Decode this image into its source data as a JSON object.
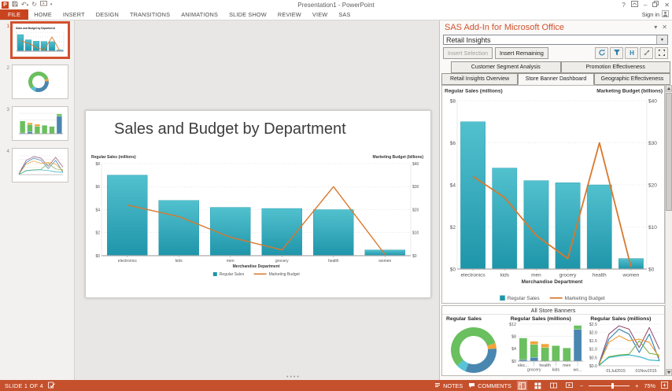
{
  "window": {
    "title": "Presentation1 - PowerPoint",
    "sign_in": "Sign in",
    "ribbon_tabs": [
      "FILE",
      "HOME",
      "INSERT",
      "DESIGN",
      "TRANSITIONS",
      "ANIMATIONS",
      "SLIDE SHOW",
      "REVIEW",
      "VIEW",
      "SAS"
    ]
  },
  "thumbnails": {
    "numbers": [
      "1",
      "2",
      "3",
      "4"
    ]
  },
  "slide": {
    "title": "Sales and Budget by Department"
  },
  "sas_panel": {
    "title": "SAS Add-In for Microsoft Office",
    "report_selector": "Retail Insights",
    "buttons": {
      "insert_selection": "Insert Selection",
      "insert_remaining": "Insert Remaining"
    },
    "tabs_row1": [
      "Customer Segment Analysis",
      "Promotion Effectiveness"
    ],
    "tabs_row2": [
      "Retail Insights Overview",
      "Store Banner Dashboard",
      "Geographic Effectiveness"
    ],
    "active_tab": "Store Banner Dashboard",
    "banners_title": "All Store Banners"
  },
  "status_bar": {
    "slide_indicator": "SLIDE 1 OF 4",
    "notes": "NOTES",
    "comments": "COMMENTS",
    "zoom": "75%"
  },
  "colors": {
    "accent_orange": "#c8441f",
    "status_bar": "#c5502c",
    "sas_header_text": "#d2512e",
    "bar_teal": "#1f95aa",
    "line_orange": "#d9782d"
  },
  "chart_data": [
    {
      "type": "bar+line",
      "categories": [
        "electronics",
        "kids",
        "men",
        "grocery",
        "health",
        "women"
      ],
      "xlabel": "Merchandise Department",
      "left_axis": {
        "label": "Regular Sales (millions)",
        "min": 0,
        "max": 8,
        "ticks": [
          "$0",
          "$2",
          "$4",
          "$6",
          "$8"
        ]
      },
      "right_axis": {
        "label": "Marketing Budget (billions)",
        "min": 0,
        "max": 40,
        "ticks": [
          "$0",
          "$10",
          "$20",
          "$30",
          "$40"
        ]
      },
      "series": [
        {
          "name": "Regular Sales",
          "type": "bar",
          "axis": "left",
          "color": "#1f95aa",
          "color_light": "#52c1ce",
          "values": [
            7.0,
            4.8,
            4.2,
            4.1,
            4.0,
            0.5
          ]
        },
        {
          "name": "Marketing Budget",
          "type": "line",
          "axis": "right",
          "color": "#d9782d",
          "values": [
            22,
            17,
            8,
            2.5,
            30,
            0.5
          ]
        }
      ],
      "legend_position": "bottom"
    },
    {
      "type": "pie",
      "title": "Regular Sales",
      "donut": true,
      "slices": [
        {
          "value": 20,
          "color": "#6abf5e"
        },
        {
          "value": 4,
          "color": "#f2a33a"
        },
        {
          "value": 32,
          "color": "#4a87b0"
        },
        {
          "value": 7,
          "color": "#56c3d8"
        },
        {
          "value": 37,
          "color": "#6abf5e"
        }
      ]
    },
    {
      "type": "bar",
      "stacked": true,
      "title": "Regular Sales (millions)",
      "categories": [
        "elec...",
        "grocery",
        "health",
        "kids",
        "men",
        "wo..."
      ],
      "ylim": [
        0,
        12
      ],
      "yticks": [
        "$0",
        "$4",
        "$8",
        "$12"
      ],
      "series": [
        {
          "color": "#4a87b0",
          "values": [
            0.5,
            1.2,
            0,
            0,
            0,
            10.3
          ]
        },
        {
          "color": "#6abf5e",
          "values": [
            7.0,
            4.2,
            4.4,
            5.0,
            4.3,
            1.3
          ]
        },
        {
          "color": "#f2a33a",
          "values": [
            0,
            1.0,
            1.2,
            0,
            0,
            0
          ]
        }
      ]
    },
    {
      "type": "line",
      "title": "Regular Sales (millions)",
      "ylim": [
        0,
        2.5
      ],
      "yticks": [
        "$0.0",
        "$0.5",
        "$1.0",
        "$1.5",
        "$2.0",
        "$2.5"
      ],
      "xticks": [
        "01Jul2015",
        "01Nov2015"
      ],
      "series": [
        {
          "color": "#964f72",
          "values": [
            0.1,
            1.9,
            2.4,
            2.2,
            1.1,
            2.3,
            1.0
          ]
        },
        {
          "color": "#2e7fae",
          "values": [
            0.1,
            1.6,
            2.2,
            1.9,
            0.8,
            1.9,
            0.3
          ]
        },
        {
          "color": "#ef9b2d",
          "values": [
            0.05,
            1.4,
            1.8,
            1.5,
            1.6,
            1.4,
            0.5
          ]
        },
        {
          "color": "#7ab648",
          "values": [
            0.0,
            0.55,
            0.65,
            0.7,
            1.5,
            0.75,
            0.65
          ]
        },
        {
          "color": "#2fb3c4",
          "values": [
            0.05,
            0.5,
            0.6,
            0.65,
            0.55,
            0.35,
            0.3
          ]
        }
      ]
    }
  ]
}
